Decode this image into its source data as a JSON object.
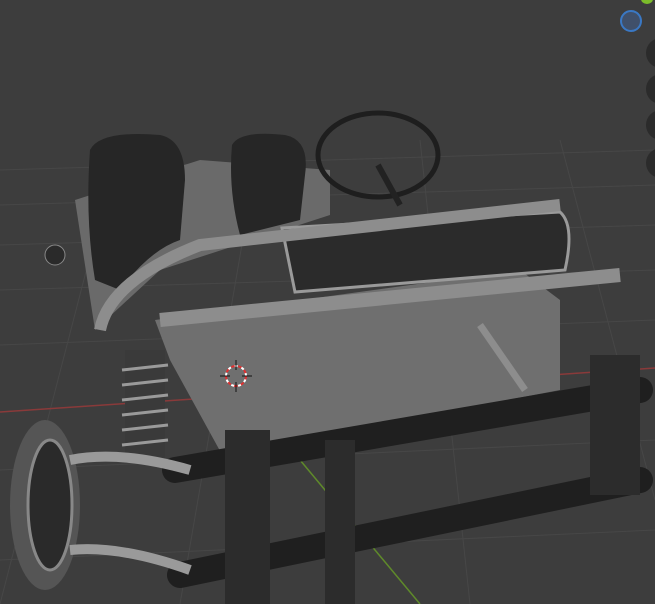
{
  "app": "3D viewport",
  "colors": {
    "background": "#3d3d3d",
    "grid": "#4a4a4a",
    "x_axis": "#8a3a3a",
    "y_axis": "#5f8a2a",
    "gizmo_blue": "#3a78c4",
    "model_body": "#6e6e6e",
    "model_dark": "#2a2a2a"
  },
  "gizmo": {
    "icon": "navigation-gizmo-icon"
  },
  "nav_buttons": [
    {
      "icon": "zoom-icon"
    },
    {
      "icon": "pan-icon"
    },
    {
      "icon": "camera-icon"
    },
    {
      "icon": "perspective-icon"
    }
  ],
  "cursor": {
    "icon": "3d-cursor-icon"
  }
}
